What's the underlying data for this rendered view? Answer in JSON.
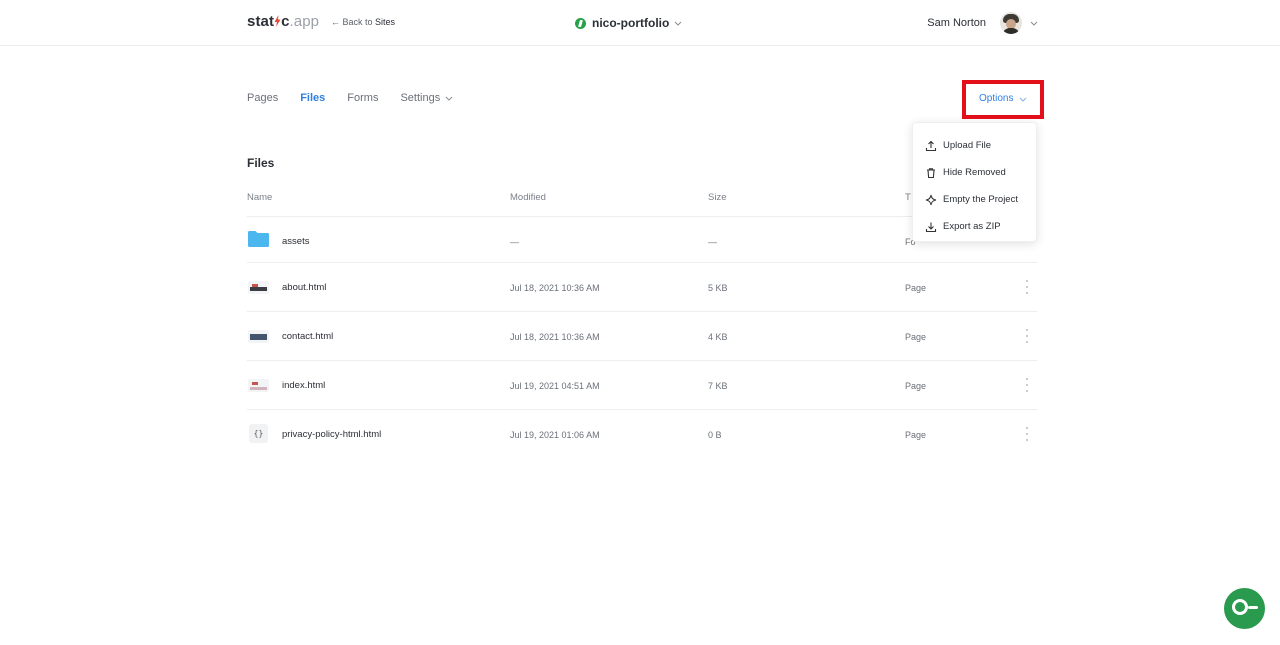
{
  "header": {
    "logo_left": "stat",
    "logo_mid": "c",
    "logo_right": ".app",
    "back_prefix": "← Back to ",
    "back_target": "Sites",
    "site_name": "nico-portfolio",
    "user_name": "Sam Norton"
  },
  "tabs": [
    {
      "label": "Pages"
    },
    {
      "label": "Files"
    },
    {
      "label": "Forms"
    },
    {
      "label": "Settings"
    }
  ],
  "options": {
    "label": "Options",
    "menu": [
      {
        "label": "Upload File",
        "icon": "upload-icon"
      },
      {
        "label": "Hide Removed",
        "icon": "trash-icon"
      },
      {
        "label": "Empty the Project",
        "icon": "sparkle-icon"
      },
      {
        "label": "Export as ZIP",
        "icon": "download-icon"
      }
    ]
  },
  "files": {
    "title": "Files",
    "columns": {
      "name": "Name",
      "modified": "Modified",
      "size": "Size",
      "type": "T"
    },
    "rows": [
      {
        "name": "assets",
        "modified": "—",
        "size": "—",
        "type": "Fo",
        "icon": "folder-icon"
      },
      {
        "name": "about.html",
        "modified": "Jul 18, 2021 10:36 AM",
        "size": "5 KB",
        "type": "Page",
        "icon": "page-thumbnail"
      },
      {
        "name": "contact.html",
        "modified": "Jul 18, 2021 10:36 AM",
        "size": "4 KB",
        "type": "Page",
        "icon": "page-thumbnail"
      },
      {
        "name": "index.html",
        "modified": "Jul 19, 2021 04:51 AM",
        "size": "7 KB",
        "type": "Page",
        "icon": "page-thumbnail"
      },
      {
        "name": "privacy-policy-html.html",
        "modified": "Jul 19, 2021 01:06 AM",
        "size": "0 B",
        "type": "Page",
        "icon": "code-file-icon"
      }
    ]
  },
  "colors": {
    "accent": "#2f7fe6",
    "highlight": "#e3101c",
    "brand_green": "#2a9a4e",
    "folder": "#4cb7ef"
  }
}
